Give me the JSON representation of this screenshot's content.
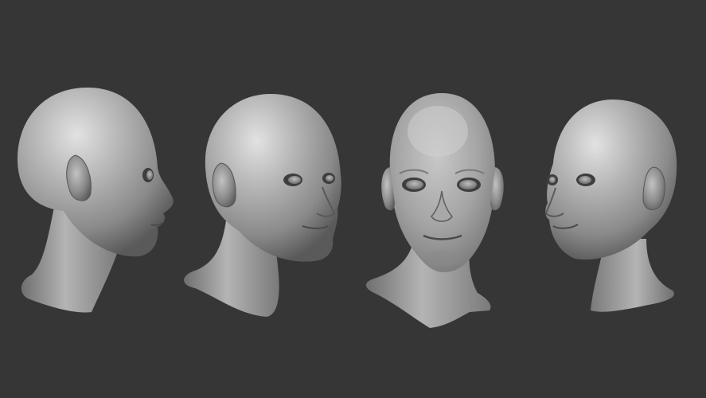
{
  "scene": {
    "background_color": "#363636",
    "skin_color": "#9a9a9a",
    "shadow_color": "#3a3a3a",
    "highlight_color": "#d8d8d8",
    "views": [
      {
        "name": "side-profile-right-facing"
      },
      {
        "name": "three-quarter-right"
      },
      {
        "name": "front-view"
      },
      {
        "name": "three-quarter-left"
      }
    ]
  }
}
